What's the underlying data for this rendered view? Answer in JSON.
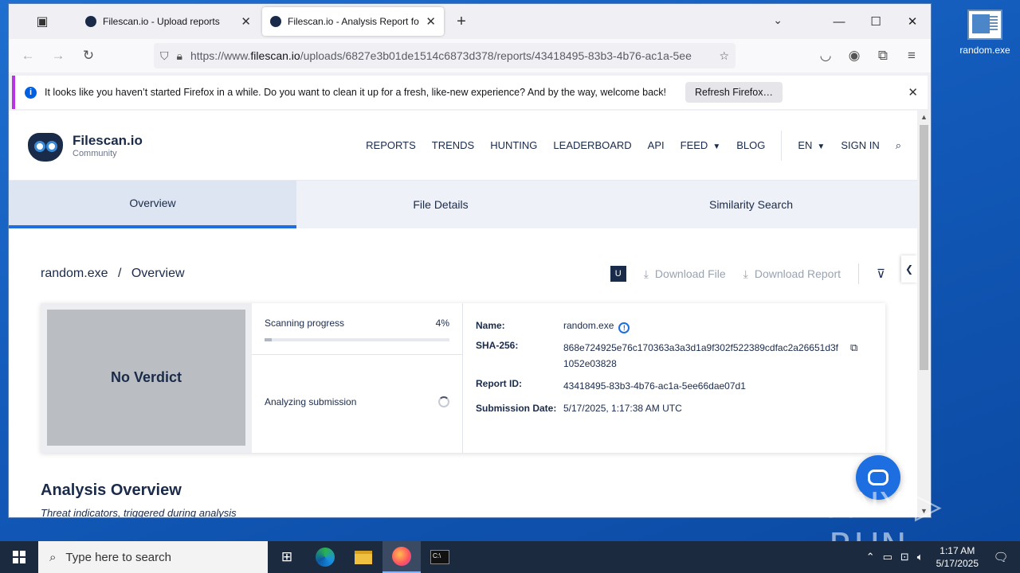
{
  "desktop": {
    "icon_label": "random.exe"
  },
  "browser": {
    "tabs": [
      {
        "title": "Filescan.io - Upload reports",
        "active": false
      },
      {
        "title": "Filescan.io - Analysis Report for",
        "active": true
      }
    ],
    "url_prefix": "https://www.",
    "url_domain": "filescan.io",
    "url_rest": "/uploads/6827e3b01de1514c6873d378/reports/43418495-83b3-4b76-ac1a-5ee",
    "infobar_text": "It looks like you haven’t started Firefox in a while. Do you want to clean it up for a fresh, like-new experience? And by the way, welcome back!",
    "refresh_button": "Refresh Firefox…"
  },
  "site": {
    "logo_name": "Filescan.io",
    "logo_sub": "Community",
    "nav": {
      "reports": "REPORTS",
      "trends": "TRENDS",
      "hunting": "HUNTING",
      "leaderboard": "LEADERBOARD",
      "api": "API",
      "feed": "FEED",
      "blog": "BLOG",
      "lang": "EN",
      "signin": "SIGN IN"
    },
    "subtabs": {
      "overview": "Overview",
      "file_details": "File Details",
      "similarity": "Similarity Search"
    }
  },
  "report": {
    "crumb_file": "random.exe",
    "crumb_sep": "/",
    "crumb_page": "Overview",
    "badge": "U",
    "download_file": "Download File",
    "download_report": "Download Report",
    "verdict": "No Verdict",
    "progress_label": "Scanning progress",
    "progress_pct": "4%",
    "progress_value": 0.04,
    "status": "Analyzing submission",
    "labels": {
      "name": "Name:",
      "sha": "SHA-256:",
      "report_id": "Report ID:",
      "submission_date": "Submission Date:"
    },
    "values": {
      "name": "random.exe",
      "sha": "868e724925e76c170363a3a3d1a9f302f522389cdfac2a26651d3f1052e03828",
      "report_id": "43418495-83b3-4b76-ac1a-5ee66dae07d1",
      "submission_date": "5/17/2025, 1:17:38 AM UTC"
    },
    "analysis_title": "Analysis Overview",
    "analysis_sub": "Threat indicators, triggered during analysis"
  },
  "watermark": "ANY ▷ RUN",
  "taskbar": {
    "search_placeholder": "Type here to search",
    "time": "1:17 AM",
    "date": "5/17/2025"
  }
}
